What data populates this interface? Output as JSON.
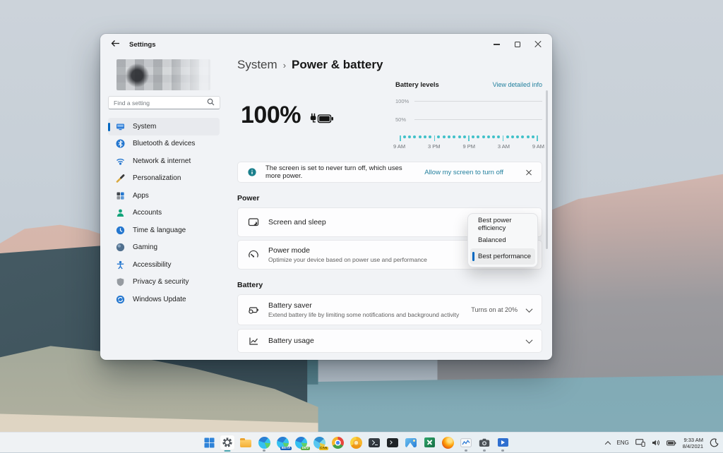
{
  "colors": {
    "accent": "#0067c0",
    "link": "#23809e",
    "teal_dots": "#3fc1c9",
    "info": "#1a7f8c"
  },
  "window": {
    "title": "Settings",
    "sidebar": {
      "search_placeholder": "Find a setting",
      "items": [
        {
          "label": "System",
          "selected": true
        },
        {
          "label": "Bluetooth & devices"
        },
        {
          "label": "Network & internet"
        },
        {
          "label": "Personalization"
        },
        {
          "label": "Apps"
        },
        {
          "label": "Accounts"
        },
        {
          "label": "Time & language"
        },
        {
          "label": "Gaming"
        },
        {
          "label": "Accessibility"
        },
        {
          "label": "Privacy & security"
        },
        {
          "label": "Windows Update"
        }
      ]
    },
    "breadcrumb": {
      "parent": "System",
      "separator": "›",
      "current": "Power & battery"
    },
    "battery_status": {
      "percent": "100%"
    },
    "battery_levels": {
      "title": "Battery levels",
      "link": "View detailed info",
      "y_ticks": [
        "100%",
        "50%"
      ],
      "x_ticks": [
        "9 AM",
        "3 PM",
        "9 PM",
        "3 AM",
        "9 AM"
      ],
      "segments": 4,
      "dots_per_segment": 6
    },
    "banner": {
      "text": "The screen is set to never turn off, which uses more power.",
      "link": "Allow my screen to turn off"
    },
    "power_section": {
      "heading": "Power",
      "rows": [
        {
          "title": "Screen and sleep"
        },
        {
          "title": "Power mode",
          "subtitle": "Optimize your device based on power use and performance"
        }
      ]
    },
    "battery_section": {
      "heading": "Battery",
      "rows": [
        {
          "title": "Battery saver",
          "subtitle": "Extend battery life by limiting some notifications and background activity",
          "value": "Turns on at 20%"
        },
        {
          "title": "Battery usage"
        }
      ]
    },
    "dropdown": {
      "options": [
        "Best power efficiency",
        "Balanced",
        "Best performance"
      ],
      "selected": "Best performance"
    }
  },
  "taskbar": {
    "icons": [
      {
        "name": "start"
      },
      {
        "name": "settings",
        "active": true
      },
      {
        "name": "file-explorer"
      },
      {
        "name": "edge",
        "running": true
      },
      {
        "name": "edge-beta",
        "badge": "BETA"
      },
      {
        "name": "edge-dev",
        "badge": "DEV"
      },
      {
        "name": "edge-canary",
        "badge": "CAN"
      },
      {
        "name": "chrome"
      },
      {
        "name": "chrome-canary"
      },
      {
        "name": "windows-terminal"
      },
      {
        "name": "command-prompt"
      },
      {
        "name": "photos"
      },
      {
        "name": "excel"
      },
      {
        "name": "firefox"
      },
      {
        "name": "task-manager",
        "running": true
      },
      {
        "name": "camera",
        "running": true
      },
      {
        "name": "movies-tv",
        "running": true
      }
    ],
    "tray": {
      "language": "ENG",
      "time": "9:33 AM",
      "date": "8/4/2021"
    }
  }
}
